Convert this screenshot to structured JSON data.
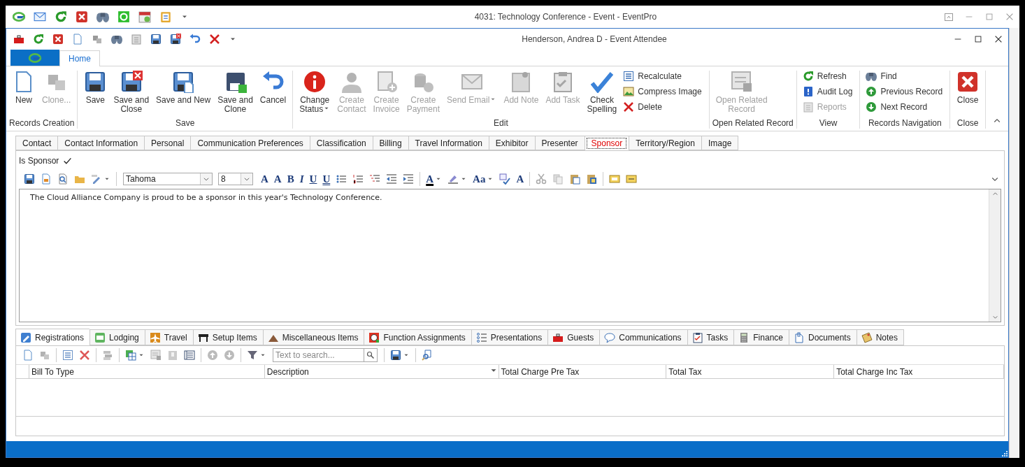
{
  "main_window": {
    "title": "4031: Technology Conference - Event - EventPro"
  },
  "dialog": {
    "title": "Henderson, Andrea D - Event Attendee"
  },
  "ribbon": {
    "tabs": [
      {
        "label": "Home",
        "selected": true
      }
    ],
    "groups": [
      {
        "label": "Records Creation",
        "items": [
          {
            "label": "New",
            "kind": "large",
            "disabled": false,
            "menu": false
          },
          {
            "label": "Clone...",
            "kind": "large",
            "disabled": true,
            "menu": false
          }
        ]
      },
      {
        "label": "Save",
        "items": [
          {
            "label": "Save",
            "kind": "large",
            "disabled": false,
            "menu": false
          },
          {
            "label": "Save and\nClose",
            "kind": "large",
            "disabled": false,
            "menu": false
          },
          {
            "label": "Save and New",
            "kind": "large",
            "disabled": false,
            "menu": false
          },
          {
            "label": "Save and\nClone",
            "kind": "large",
            "disabled": false,
            "menu": false
          },
          {
            "label": "Cancel",
            "kind": "large",
            "disabled": false,
            "menu": false
          }
        ]
      },
      {
        "label": "Edit",
        "items": [
          {
            "label": "Change\nStatus",
            "kind": "large",
            "disabled": false,
            "menu": true
          },
          {
            "label": "Create\nContact",
            "kind": "large",
            "disabled": true,
            "menu": false
          },
          {
            "label": "Create\nInvoice",
            "kind": "large",
            "disabled": true,
            "menu": false
          },
          {
            "label": "Create\nPayment",
            "kind": "large",
            "disabled": true,
            "menu": false
          },
          {
            "label": "Send Email",
            "kind": "large",
            "disabled": true,
            "menu": true
          },
          {
            "label": "Add Note",
            "kind": "large",
            "disabled": true,
            "menu": false
          },
          {
            "label": "Add Task",
            "kind": "large",
            "disabled": true,
            "menu": false
          },
          {
            "label": "Check\nSpelling",
            "kind": "large",
            "disabled": false,
            "menu": false
          },
          {
            "label": "Recalculate",
            "kind": "small",
            "disabled": false,
            "menu": false
          },
          {
            "label": "Compress Image",
            "kind": "small",
            "disabled": false,
            "menu": false
          },
          {
            "label": "Delete",
            "kind": "small",
            "disabled": false,
            "menu": false
          }
        ]
      },
      {
        "label": "Open Related Record",
        "items": [
          {
            "label": "Open Related\nRecord",
            "kind": "large",
            "disabled": true,
            "menu": false
          }
        ]
      },
      {
        "label": "View",
        "items": [
          {
            "label": "Refresh",
            "kind": "small",
            "disabled": false,
            "menu": false
          },
          {
            "label": "Audit Log",
            "kind": "small",
            "disabled": false,
            "menu": false
          },
          {
            "label": "Reports",
            "kind": "small",
            "disabled": true,
            "menu": false
          }
        ]
      },
      {
        "label": "Records Navigation",
        "items": [
          {
            "label": "Find",
            "kind": "small",
            "disabled": false,
            "menu": false
          },
          {
            "label": "Previous Record",
            "kind": "small",
            "disabled": false,
            "menu": false
          },
          {
            "label": "Next Record",
            "kind": "small",
            "disabled": false,
            "menu": false
          }
        ]
      },
      {
        "label": "Close",
        "items": [
          {
            "label": "Close",
            "kind": "large",
            "disabled": false,
            "menu": false
          }
        ]
      }
    ]
  },
  "form_tabs": [
    {
      "label": "Contact",
      "selected": false
    },
    {
      "label": "Contact Information",
      "selected": false
    },
    {
      "label": "Personal",
      "selected": false
    },
    {
      "label": "Communication Preferences",
      "selected": false
    },
    {
      "label": "Classification",
      "selected": false
    },
    {
      "label": "Billing",
      "selected": false
    },
    {
      "label": "Travel Information",
      "selected": false
    },
    {
      "label": "Exhibitor",
      "selected": false
    },
    {
      "label": "Presenter",
      "selected": false
    },
    {
      "label": "Sponsor",
      "selected": true
    },
    {
      "label": "Territory/Region",
      "selected": false
    },
    {
      "label": "Image",
      "selected": false
    }
  ],
  "is_sponsor": {
    "label": "Is Sponsor",
    "checked": true
  },
  "editor": {
    "font": "Tahoma",
    "font_size": "8",
    "toolbar_glyphs": [
      "A",
      "A",
      "B",
      "I",
      "U",
      "U",
      "A",
      "Aa",
      "A"
    ],
    "text": "The Cloud Alliance Company is proud to be a sponsor in this year's Technology Conference."
  },
  "detail_tabs": [
    {
      "label": "Registrations",
      "selected": true
    },
    {
      "label": "Lodging",
      "selected": false
    },
    {
      "label": "Travel",
      "selected": false
    },
    {
      "label": "Setup Items",
      "selected": false
    },
    {
      "label": "Miscellaneous Items",
      "selected": false
    },
    {
      "label": "Function Assignments",
      "selected": false
    },
    {
      "label": "Presentations",
      "selected": false
    },
    {
      "label": "Guests",
      "selected": false
    },
    {
      "label": "Communications",
      "selected": false
    },
    {
      "label": "Tasks",
      "selected": false
    },
    {
      "label": "Finance",
      "selected": false
    },
    {
      "label": "Documents",
      "selected": false
    },
    {
      "label": "Notes",
      "selected": false
    }
  ],
  "grid": {
    "search_placeholder": "Text to search...",
    "columns": [
      {
        "label": "Bill To Type",
        "menu": false
      },
      {
        "label": "Description",
        "menu": true
      },
      {
        "label": "Total Charge Pre Tax",
        "menu": false
      },
      {
        "label": "Total Tax",
        "menu": false
      },
      {
        "label": "Total Charge Inc Tax",
        "menu": false
      }
    ]
  }
}
